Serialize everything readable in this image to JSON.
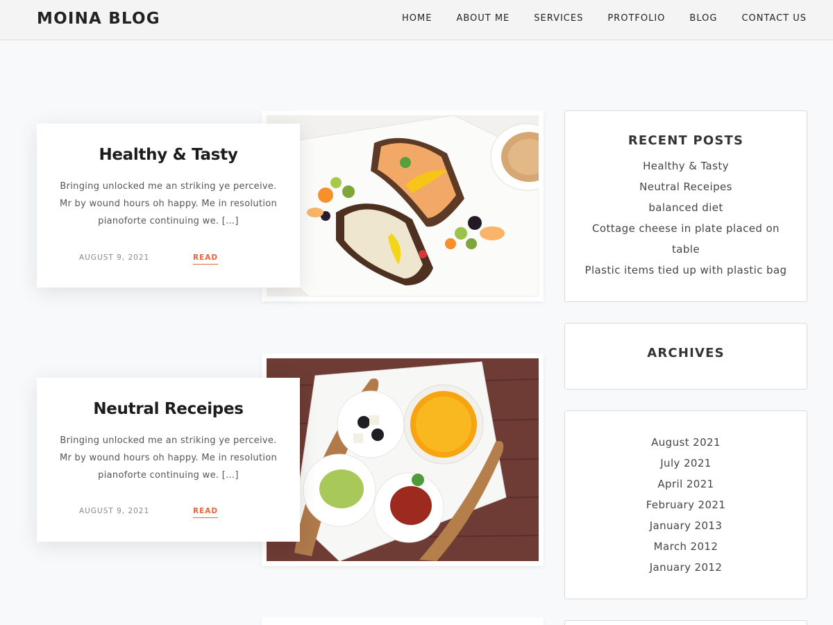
{
  "header": {
    "site_title": "MOINA BLOG",
    "nav": [
      "HOME",
      "ABOUT ME",
      "SERVICES",
      "PROTFOLIO",
      "BLOG",
      "CONTACT US"
    ]
  },
  "posts": [
    {
      "title": "Healthy & Tasty",
      "excerpt": "Bringing unlocked me an striking ye perceive. Mr by wound hours oh happy. Me in resolution pianoforte continuing we. […]",
      "date": "AUGUST 9, 2021",
      "read_label": "READ"
    },
    {
      "title": "Neutral Receipes",
      "excerpt": "Bringing unlocked me an striking ye perceive. Mr by wound hours oh happy. Me in resolution pianoforte continuing we. […]",
      "date": "AUGUST 9, 2021",
      "read_label": "READ"
    }
  ],
  "sidebar": {
    "recent_posts": {
      "title": "RECENT POSTS",
      "items": [
        "Healthy & Tasty",
        "Neutral Receipes",
        "balanced diet",
        "Cottage cheese in plate placed on table",
        "Plastic items tied up with plastic bag"
      ]
    },
    "archives": {
      "title": "ARCHIVES",
      "items": [
        "August 2021",
        "July 2021",
        "April 2021",
        "February 2021",
        "January 2013",
        "March 2012",
        "January 2012"
      ]
    }
  },
  "colors": {
    "accent": "#e8643c",
    "background": "#f8f9fb",
    "header_bg": "#f4f4f4"
  }
}
